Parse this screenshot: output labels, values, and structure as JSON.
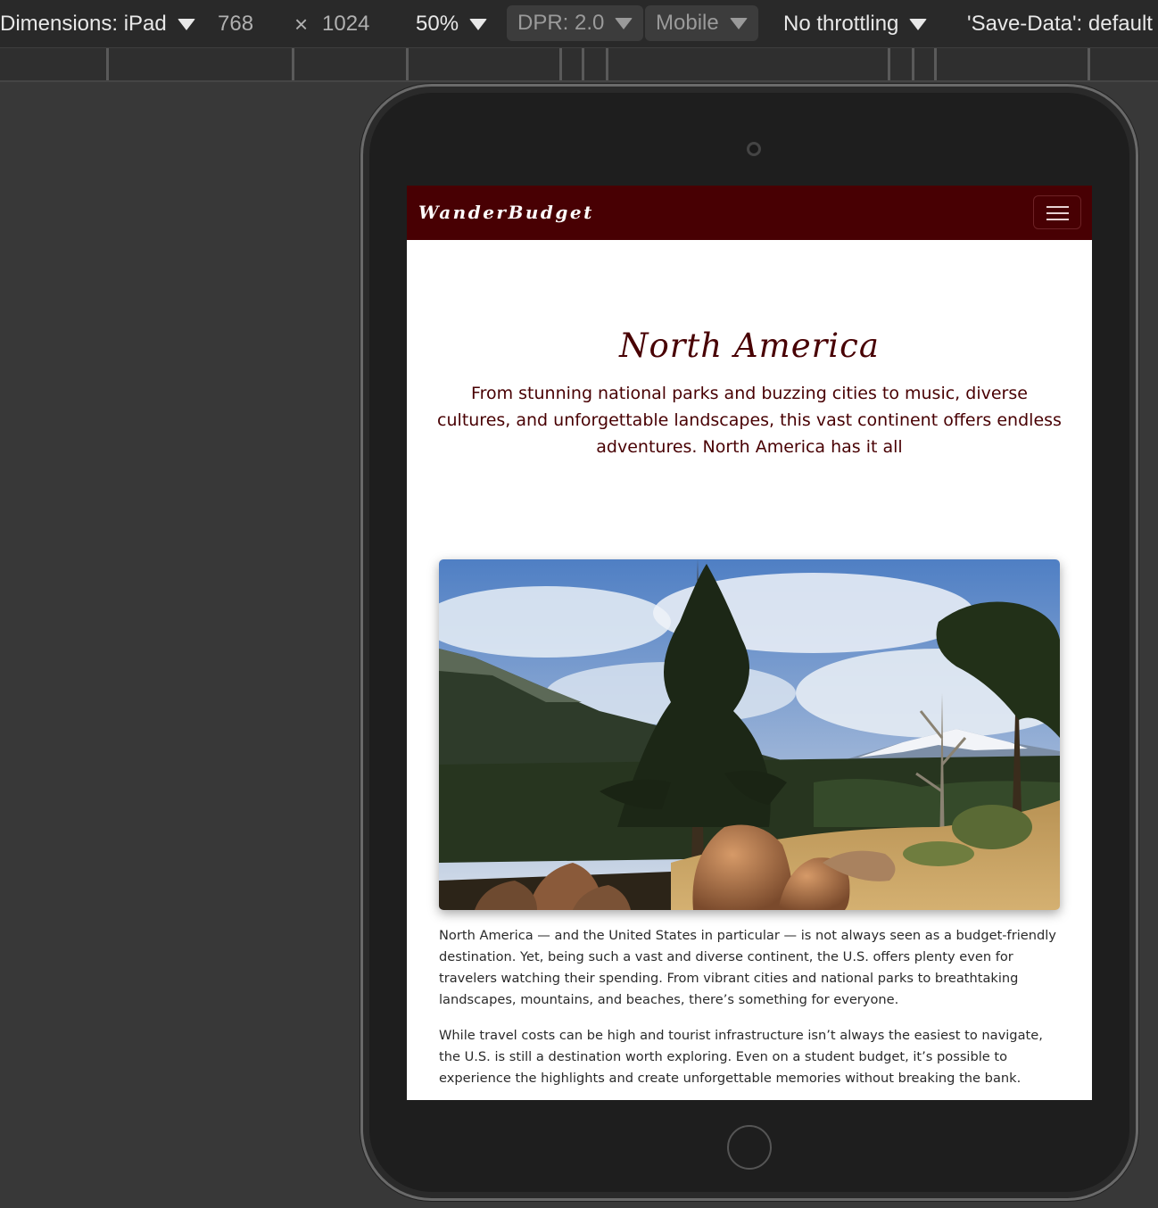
{
  "devtools": {
    "dimensions_label": "Dimensions: iPad",
    "width": "768",
    "times": "×",
    "height": "1024",
    "zoom": "50%",
    "dpr": "DPR: 2.0",
    "mode": "Mobile",
    "throttling": "No throttling",
    "save_data": "'Save-Data': default"
  },
  "site": {
    "brand": "WanderBudget",
    "hero": {
      "title": "North America",
      "subtitle": "From stunning national parks and buzzing cities to music, diverse cultures, and unforgettable landscapes, this vast continent offers endless adventures. North America has it all"
    },
    "paragraphs": [
      "North America — and the United States in particular — is not always seen as a budget-friendly destination. Yet, being such a vast and diverse continent, the U.S. offers plenty even for travelers watching their spending. From vibrant cities and national parks to breathtaking landscapes, mountains, and beaches, there’s something for everyone.",
      "While travel costs can be high and tourist infrastructure isn’t always the easiest to navigate, the U.S. is still a destination worth exploring. Even on a student budget, it’s possible to experience the highlights and create unforgettable memories without breaking the bank."
    ]
  },
  "colors": {
    "brand_maroon": "#480003",
    "devtools_bg": "#292929",
    "canvas_bg": "#383838"
  },
  "icons": {
    "menu": "hamburger-menu-icon",
    "dropdown": "chevron-down-icon",
    "camera": "camera-icon",
    "home": "home-button-icon"
  }
}
